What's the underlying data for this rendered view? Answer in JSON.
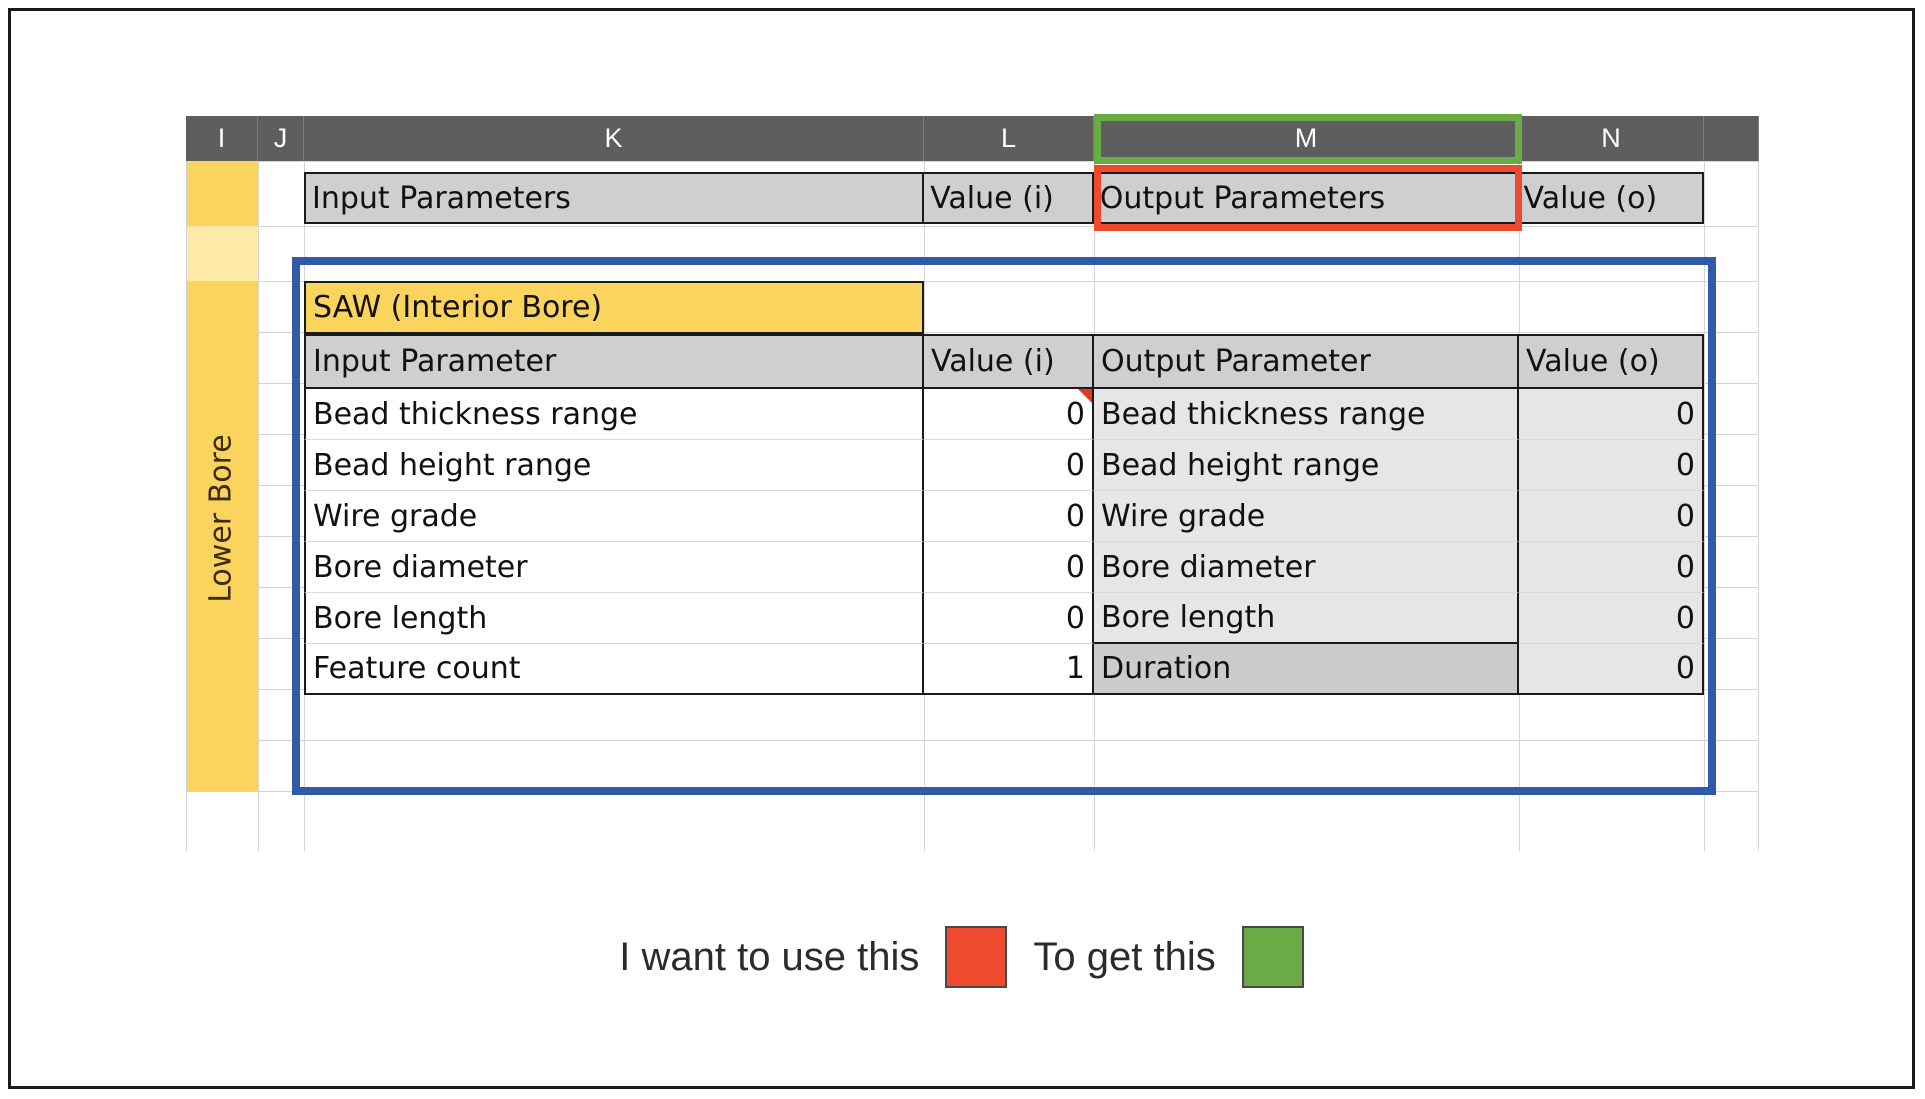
{
  "sheet": {
    "column_headers": [
      "I",
      "J",
      "K",
      "L",
      "M",
      "N"
    ],
    "row_label": "Lower Bore"
  },
  "outer_band": {
    "input_parameters": "Input Parameters",
    "value_i": "Value (i)",
    "output_parameters": "Output Parameters",
    "value_o": "Value (o)"
  },
  "inner_table": {
    "title": "SAW (Interior Bore)",
    "headers": {
      "input_parameter": "Input Parameter",
      "value_i": "Value (i)",
      "output_parameter": "Output Parameter",
      "value_o": "Value (o)"
    },
    "rows": [
      {
        "input": "Bead thickness range",
        "value_i": "0",
        "output": "Bead thickness range",
        "value_o": "0"
      },
      {
        "input": "Bead height range",
        "value_i": "0",
        "output": "Bead height range",
        "value_o": "0"
      },
      {
        "input": "Wire grade",
        "value_i": "0",
        "output": "Wire grade",
        "value_o": "0"
      },
      {
        "input": "Bore diameter",
        "value_i": "0",
        "output": "Bore diameter",
        "value_o": "0"
      },
      {
        "input": "Bore length",
        "value_i": "0",
        "output": "Bore length",
        "value_o": "0"
      },
      {
        "input": "Feature count",
        "value_i": "1",
        "output": "Duration",
        "value_o": "0"
      }
    ]
  },
  "caption": {
    "use_text": "I want to use this",
    "get_text": "To get this"
  },
  "colors": {
    "highlight_green": "#6aab46",
    "highlight_red": "#ef4a2d",
    "selection_blue": "#2f5aa8",
    "header_gray": "#5e5e5e",
    "title_yellow": "#fad45c",
    "band_gray": "#cfcfcf",
    "output_gray": "#e6e6e6",
    "duration_gray": "#cccccc"
  }
}
